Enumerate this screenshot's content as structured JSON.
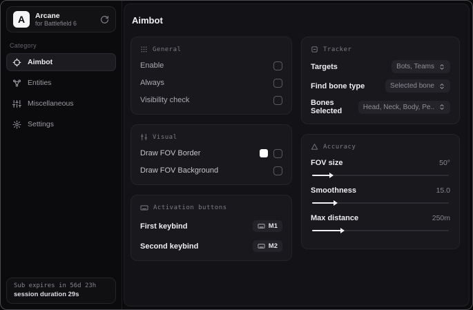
{
  "app": {
    "logo_letter": "A",
    "name": "Arcane",
    "subtitle": "for Battlefield 6"
  },
  "sidebar": {
    "category_label": "Category",
    "items": [
      {
        "label": "Aimbot",
        "icon": "crosshair-icon",
        "active": true
      },
      {
        "label": "Entities",
        "icon": "entities-icon",
        "active": false
      },
      {
        "label": "Miscellaneous",
        "icon": "sliders-icon",
        "active": false
      },
      {
        "label": "Settings",
        "icon": "gear-icon",
        "active": false
      }
    ],
    "footer": {
      "sub_expires": "Sub expires in 56d 23h",
      "session_duration": "session duration 29s"
    }
  },
  "main": {
    "title": "Aimbot",
    "cards": {
      "general": {
        "title": "General",
        "icon": "grid-icon",
        "rows": [
          {
            "label": "Enable",
            "checked": false
          },
          {
            "label": "Always",
            "checked": false
          },
          {
            "label": "Visibility check",
            "checked": false
          }
        ]
      },
      "visual": {
        "title": "Visual",
        "icon": "sliders-icon",
        "rows": [
          {
            "label": "Draw FOV Border",
            "swatch_color": "#ffffff",
            "checked": false
          },
          {
            "label": "Draw FOV Background",
            "checked": false
          }
        ]
      },
      "activation": {
        "title": "Activation buttons",
        "icon": "keyboard-icon",
        "rows": [
          {
            "label": "First keybind",
            "key": "M1"
          },
          {
            "label": "Second keybind",
            "key": "M2"
          }
        ]
      },
      "tracker": {
        "title": "Tracker",
        "icon": "scan-icon",
        "rows": [
          {
            "label": "Targets",
            "value": "Bots, Teams"
          },
          {
            "label": "Find bone type",
            "value": "Selected bone"
          },
          {
            "label": "Bones Selected",
            "value": "Head, Neck, Body, Pe.."
          }
        ]
      },
      "accuracy": {
        "title": "Accuracy",
        "icon": "triangle-icon",
        "rows": [
          {
            "label": "FOV size",
            "value": "50°",
            "percent": 13
          },
          {
            "label": "Smoothness",
            "value": "15.0",
            "percent": 16
          },
          {
            "label": "Max distance",
            "value": "250m",
            "percent": 21
          }
        ]
      }
    }
  },
  "colors": {
    "window_bg": "#0b0b0d",
    "panel_bg": "#131317",
    "card_bg": "#18181d",
    "accent_fill": "#f2f2f4",
    "swatch": "#ffffff"
  }
}
